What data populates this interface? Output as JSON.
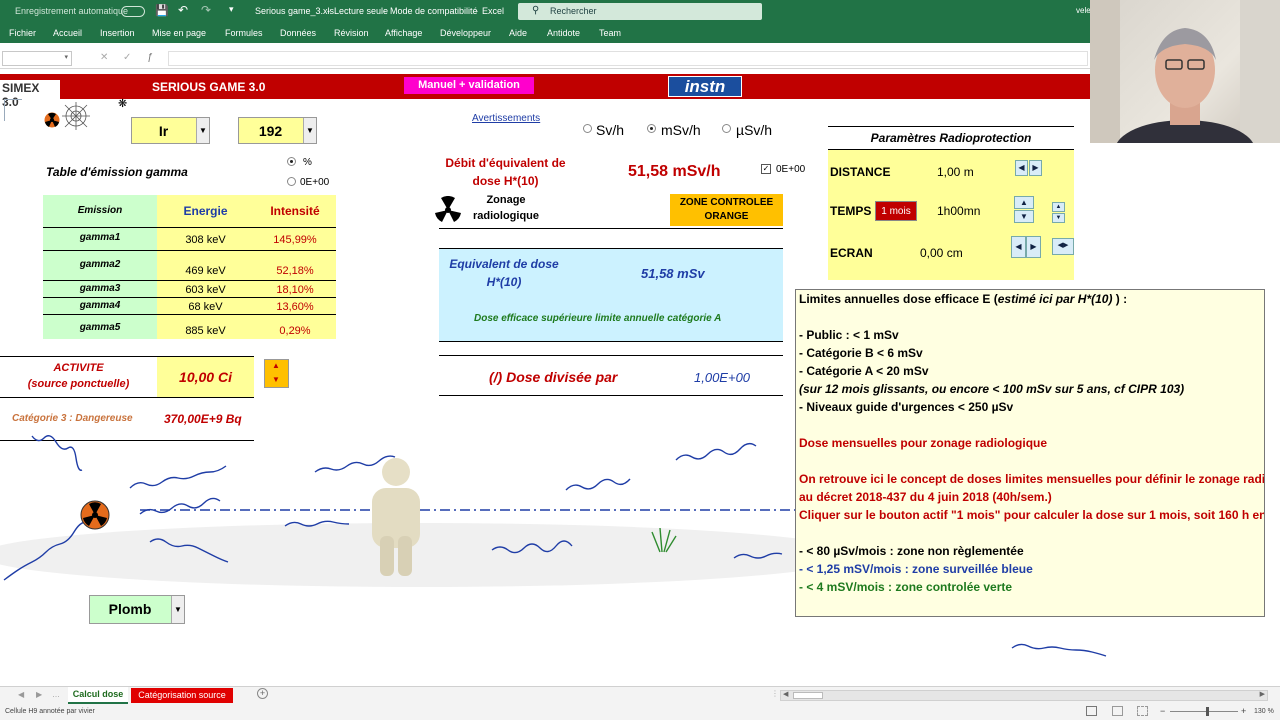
{
  "window": {
    "autosave_label": "Enregistrement automatique",
    "file_title": "Serious game_3.xls",
    "readonly": "Lecture seule",
    "compat": "Mode de compatibilité",
    "app": "Excel",
    "search_placeholder": "Rechercher",
    "user": "vele"
  },
  "ribbon": [
    "Fichier",
    "Accueil",
    "Insertion",
    "Mise en page",
    "Formules",
    "Données",
    "Révision",
    "Affichage",
    "Développeur",
    "Aide",
    "Antidote",
    "Team"
  ],
  "banner": {
    "logo": "SIMEX 3.0",
    "title": "SERIOUS GAME 3.0",
    "manuel_button": "Manuel + validation",
    "instn_logo": "instn"
  },
  "source": {
    "isotope": "Ir",
    "mass_number": "192",
    "table_title": "Table d'émission gamma",
    "unit_options": [
      "%",
      "0E+00"
    ],
    "table_headers": [
      "Emission",
      "Energie",
      "Intensité"
    ],
    "emissions": [
      {
        "name": "gamma1",
        "energy": "308 keV",
        "intensity": "145,99%"
      },
      {
        "name": "gamma2",
        "energy": "469 keV",
        "intensity": "52,18%"
      },
      {
        "name": "gamma3",
        "energy": "603 keV",
        "intensity": "18,10%"
      },
      {
        "name": "gamma4",
        "energy": "68 keV",
        "intensity": "13,60%"
      },
      {
        "name": "gamma5",
        "energy": "885 keV",
        "intensity": "0,29%"
      }
    ],
    "activity_label_1": "ACTIVITE",
    "activity_label_2": "(source ponctuelle)",
    "activity_value": "10,00 Ci",
    "category": "Catégorie 3 : Dangereuse",
    "activity_bq": "370,00E+9 Bq",
    "shield_material": "Plomb"
  },
  "center": {
    "avertissement_link": "Avertissements",
    "rate_units": [
      "Sv/h",
      "mSv/h",
      "µSv/h"
    ],
    "selected_unit": "mSv/h",
    "dose_rate_label_1": "Débit d'équivalent de",
    "dose_rate_label_2": "dose H*(10)",
    "dose_rate_value": "51,58 mSv/h",
    "checkbox_label": "0E+00",
    "zonage_label_1": "Zonage",
    "zonage_label_2": "radiologique",
    "zone_badge_1": "ZONE CONTROLEE",
    "zone_badge_2": "ORANGE",
    "eq_dose_label_1": "Equivalent de dose",
    "eq_dose_label_2": "H*(10)",
    "eq_dose_value": "51,58 mSv",
    "eq_dose_msg": "Dose efficace supérieure limite annuelle catégorie A",
    "divided_label": "(/) Dose divisée par",
    "divided_value": "1,00E+00"
  },
  "params": {
    "title": "Paramètres Radioprotection",
    "distance_label": "DISTANCE",
    "distance_value": "1,00 m",
    "temps_label": "TEMPS",
    "temps_button": "1 mois",
    "temps_value": "1h00mn",
    "ecran_label": "ECRAN",
    "ecran_value": "0,00  cm"
  },
  "comment": {
    "line1_a": "Limites annuelles  dose efficace E (",
    "line1_b": "estimé ici par H*(10)",
    "line1_c": "  ) :",
    "public": "- Public  : < 1 mSv",
    "cat_b": "- Catégorie B  < 6 mSv",
    "cat_a": "- Catégorie A  < 20 mSv",
    "note": "(sur 12 mois glissants, ou encore < 100 mSv sur 5 ans, cf CIPR 103)",
    "guide": "- Niveaux guide d'urgences < 250 µSv",
    "mensuel_title": "Dose mensuelles  pour zonage radiologique",
    "red1": "On retrouve ici le concept de doses limites mensuelles pour définir le zonage radi",
    "red2": "au décret 2018-437 du 4 juin 2018 (40h/sem.)",
    "red3": "Cliquer sur le bouton actif \"1 mois\" pour calculer la dose sur 1 mois, soit 160 h en",
    "zone_nr": "-  < 80 µSv/mois    :  zone non règlementée",
    "zone_blue": "- < 1,25 mSV/mois :  zone surveillée bleue",
    "zone_green": "-  < 4  mSV/mois   : zone controlée verte"
  },
  "tabs": [
    "Calcul dose",
    "Catégorisation source"
  ],
  "status": {
    "left": "Cellule H9 annotée par vivier",
    "zoom": "130 %"
  },
  "colors": {
    "excel_green": "#217346",
    "banner_red": "#c00000",
    "cell_yellow": "#ffff99",
    "table_green": "#ccffcc",
    "zone_orange": "#ffc000",
    "dose_red": "#c00000",
    "eq_cyan": "#ccf2ff"
  }
}
